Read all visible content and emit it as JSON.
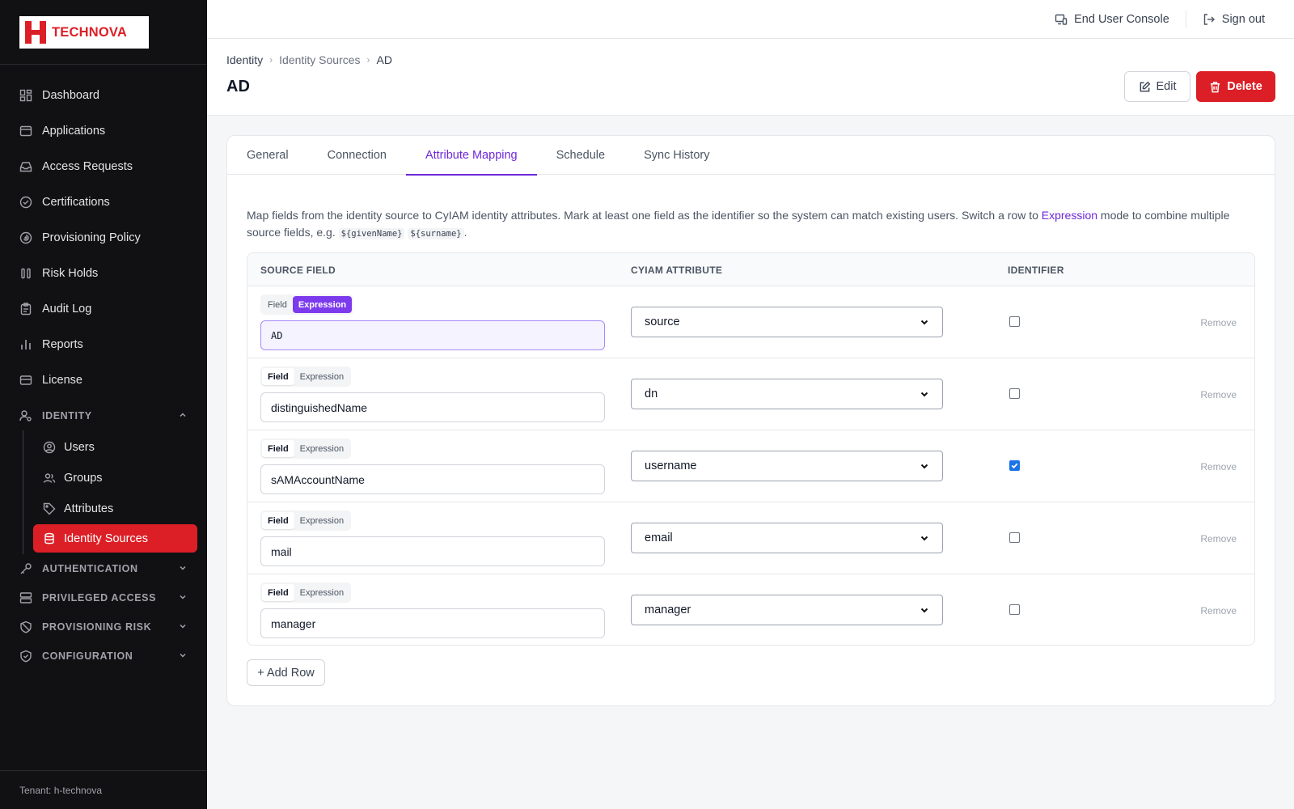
{
  "brand": {
    "name": "TECHNOVA",
    "accent": "#dc1f26"
  },
  "sidebar": {
    "items": [
      {
        "label": "Dashboard",
        "icon": "dashboard-icon"
      },
      {
        "label": "Applications",
        "icon": "window-icon"
      },
      {
        "label": "Access Requests",
        "icon": "inbox-icon"
      },
      {
        "label": "Certifications",
        "icon": "check-circle-icon"
      },
      {
        "label": "Provisioning Policy",
        "icon": "policy-icon"
      },
      {
        "label": "Risk Holds",
        "icon": "pause-icon"
      },
      {
        "label": "Audit Log",
        "icon": "clipboard-icon"
      },
      {
        "label": "Reports",
        "icon": "bar-chart-icon"
      },
      {
        "label": "License",
        "icon": "card-icon"
      }
    ],
    "identity_section": "IDENTITY",
    "identity_items": [
      {
        "label": "Users"
      },
      {
        "label": "Groups"
      },
      {
        "label": "Attributes"
      },
      {
        "label": "Identity Sources"
      }
    ],
    "sections": [
      {
        "label": "AUTHENTICATION"
      },
      {
        "label": "PRIVILEGED ACCESS"
      },
      {
        "label": "PROVISIONING RISK"
      },
      {
        "label": "CONFIGURATION"
      }
    ],
    "tenant": "Tenant: h-technova"
  },
  "topbar": {
    "console": "End User Console",
    "signout": "Sign out"
  },
  "breadcrumb": [
    "Identity",
    "Identity Sources",
    "AD"
  ],
  "page": {
    "title": "AD",
    "edit": "Edit",
    "delete": "Delete"
  },
  "tabs": [
    "General",
    "Connection",
    "Attribute Mapping",
    "Schedule",
    "Sync History"
  ],
  "active_tab": "Attribute Mapping",
  "description": {
    "part1": "Map fields from the identity source to CyIAM identity attributes. Mark at least one field as the identifier so the system can match existing users. Switch a row to ",
    "link": "Expression",
    "part2": " mode to combine multiple source fields, e.g. ",
    "code1": "${givenName}",
    "code2": "${surname}",
    "part3": "."
  },
  "table": {
    "headers": {
      "source": "SOURCE FIELD",
      "attr": "CYIAM ATTRIBUTE",
      "ident": "IDENTIFIER"
    },
    "mode_labels": {
      "field": "Field",
      "expression": "Expression"
    },
    "remove_label": "Remove",
    "rows": [
      {
        "mode": "expression",
        "source": "AD",
        "attribute": "source",
        "identifier": false
      },
      {
        "mode": "field",
        "source": "distinguishedName",
        "attribute": "dn",
        "identifier": false
      },
      {
        "mode": "field",
        "source": "sAMAccountName",
        "attribute": "username",
        "identifier": true
      },
      {
        "mode": "field",
        "source": "mail",
        "attribute": "email",
        "identifier": false
      },
      {
        "mode": "field",
        "source": "manager",
        "attribute": "manager",
        "identifier": false
      }
    ]
  },
  "add_row": "+ Add Row"
}
